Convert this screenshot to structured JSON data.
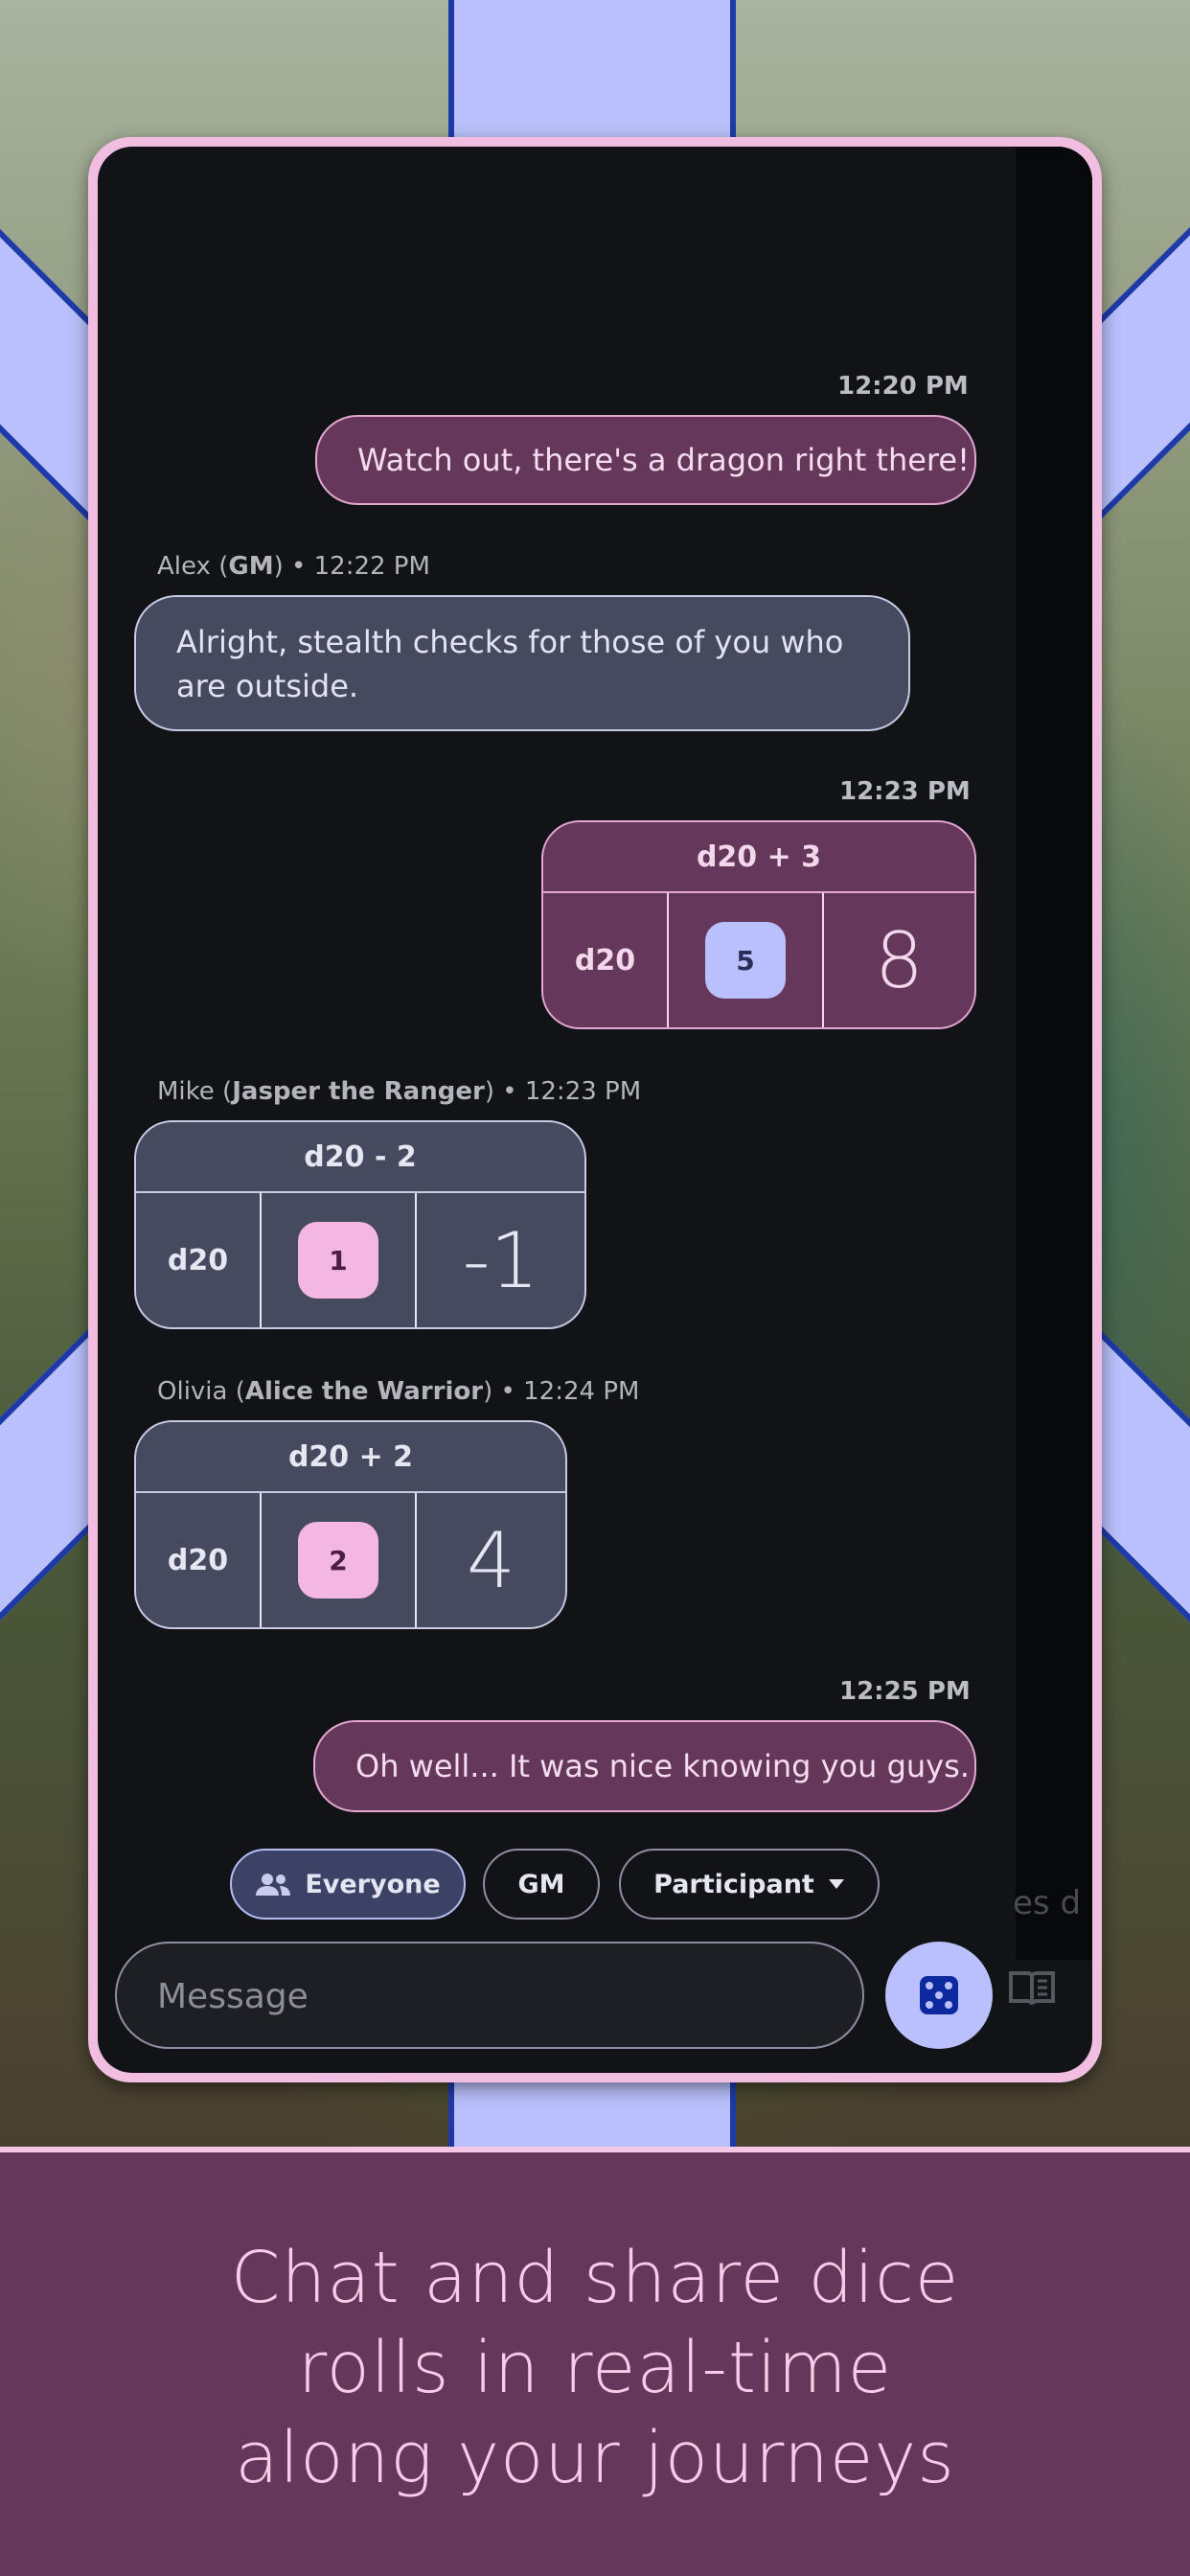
{
  "chat": {
    "messages": [
      {
        "time": "12:20 PM",
        "text": "Watch out, there's a dragon right there!"
      },
      {
        "sender": "Alex",
        "role": "GM",
        "time": "12:22 PM",
        "sep": " • ",
        "text": "Alright, stealth checks for those of you who are outside."
      },
      {
        "time": "12:23 PM",
        "roll": {
          "formula": "d20 + 3",
          "die": "d20",
          "value": "5",
          "result": "8"
        }
      },
      {
        "sender": "Mike",
        "role": "Jasper the Ranger",
        "time": "12:23 PM",
        "sep": " • ",
        "roll": {
          "formula": "d20 - 2",
          "die": "d20",
          "value": "1",
          "result": "-1"
        }
      },
      {
        "sender": "Olivia",
        "role": "Alice the Warrior",
        "time": "12:24 PM",
        "sep": " • ",
        "roll": {
          "formula": "d20 + 2",
          "die": "d20",
          "value": "2",
          "result": "4"
        }
      },
      {
        "time": "12:25 PM",
        "text": "Oh well... It was nice knowing you guys."
      }
    ]
  },
  "recipients": {
    "everyone": "Everyone",
    "gm": "GM",
    "participant": "Participant"
  },
  "ghost_text": "es d",
  "composer": {
    "placeholder": "Message"
  },
  "tagline": {
    "line1": "Chat and share dice",
    "line2": "rolls in real-time",
    "line3": "along your journeys"
  },
  "colors": {
    "accent_pink": "#f1bde0",
    "accent_blue": "#b9c0fb",
    "band": "#65375a"
  }
}
